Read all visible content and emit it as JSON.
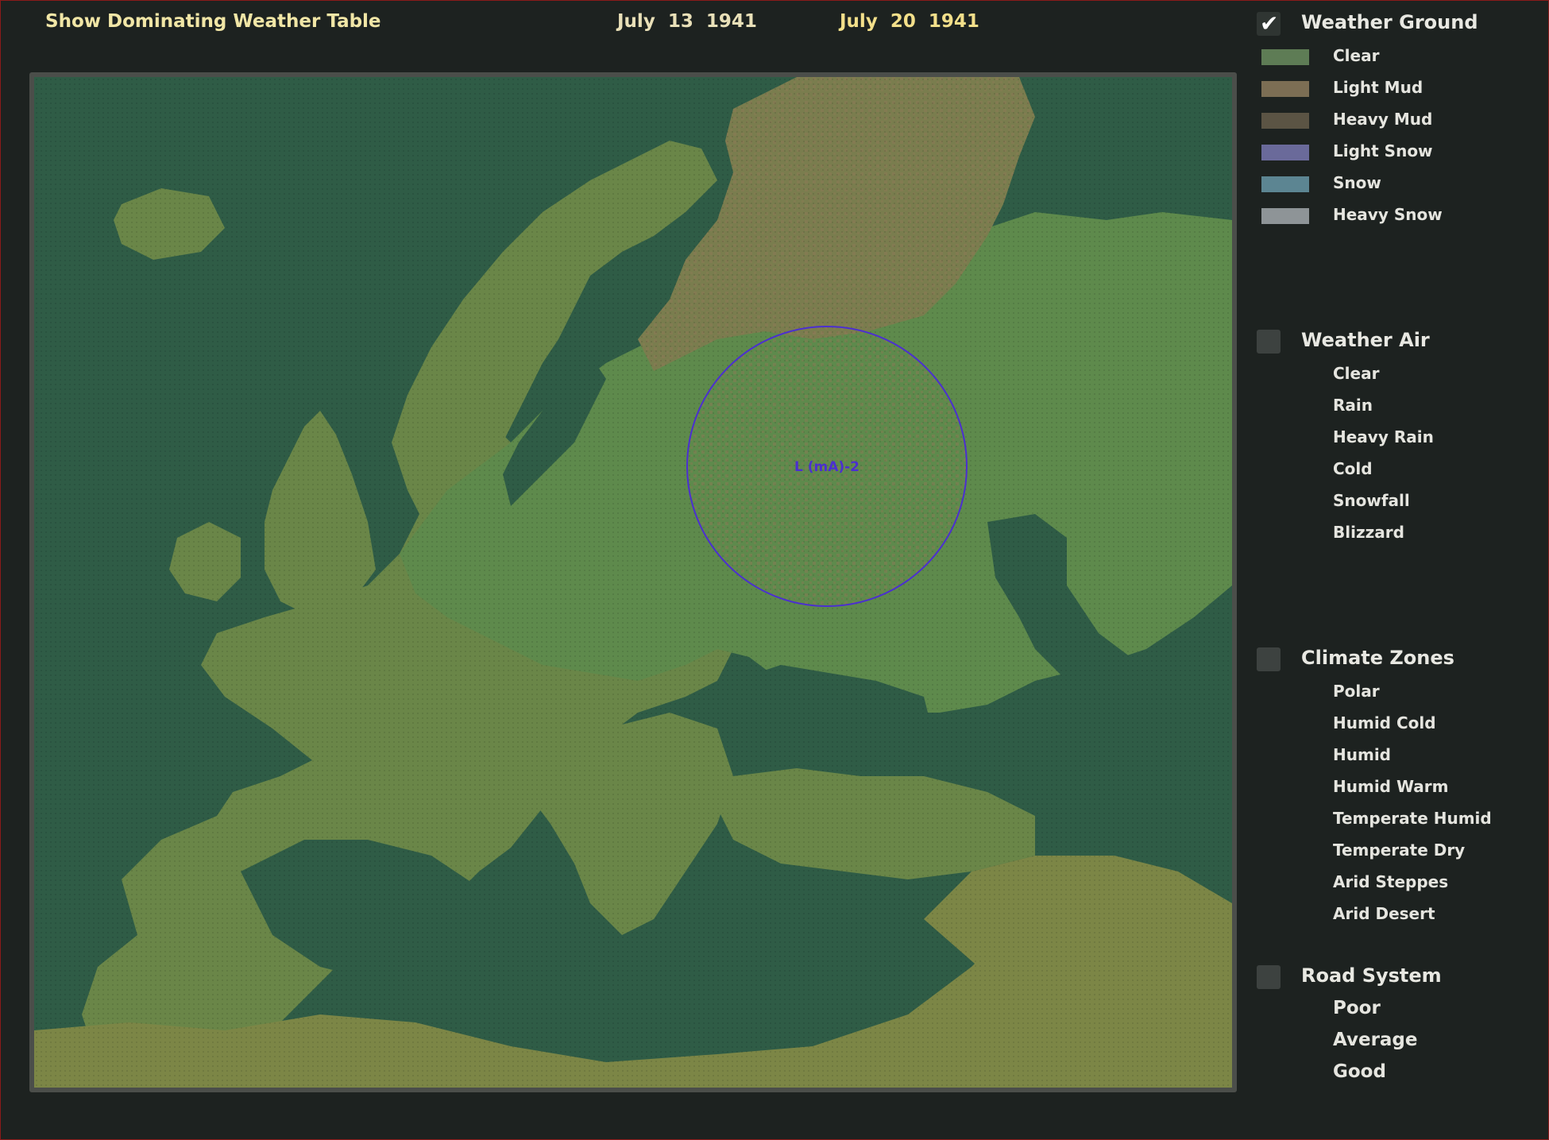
{
  "header": {
    "dominating_table_link": "Show Dominating Weather Table",
    "date_start": "July  13  1941",
    "date_end": "July  20  1941"
  },
  "map": {
    "front_label": "L (mA)-2",
    "colors": {
      "sea": "#2f5c46",
      "land_clear": "#5e8a4c",
      "land_temperate": "#6a8648",
      "mud": "#7a7d4e",
      "desert": "#7c8646",
      "front_circle": "#4b2fd0"
    }
  },
  "legend": {
    "weather_ground": {
      "title": "Weather Ground",
      "checked": true,
      "items": [
        {
          "label": "Clear",
          "color": "#5e7c55"
        },
        {
          "label": "Light Mud",
          "color": "#7c6e54"
        },
        {
          "label": "Heavy Mud",
          "color": "#5b5444"
        },
        {
          "label": "Light Snow",
          "color": "#6a6a9a"
        },
        {
          "label": "Snow",
          "color": "#5c8592"
        },
        {
          "label": "Heavy Snow",
          "color": "#8e9497"
        }
      ]
    },
    "weather_air": {
      "title": "Weather Air",
      "checked": false,
      "items": [
        {
          "label": "Clear"
        },
        {
          "label": "Rain"
        },
        {
          "label": "Heavy Rain"
        },
        {
          "label": "Cold"
        },
        {
          "label": "Snowfall"
        },
        {
          "label": "Blizzard"
        }
      ]
    },
    "climate_zones": {
      "title": "Climate Zones",
      "checked": false,
      "items": [
        {
          "label": "Polar"
        },
        {
          "label": "Humid Cold"
        },
        {
          "label": "Humid"
        },
        {
          "label": "Humid Warm"
        },
        {
          "label": "Temperate Humid"
        },
        {
          "label": "Temperate Dry"
        },
        {
          "label": "Arid Steppes"
        },
        {
          "label": "Arid Desert"
        }
      ]
    },
    "road_system": {
      "title": "Road System",
      "checked": false,
      "items": [
        {
          "label": "Poor"
        },
        {
          "label": "Average"
        },
        {
          "label": "Good"
        }
      ]
    }
  }
}
